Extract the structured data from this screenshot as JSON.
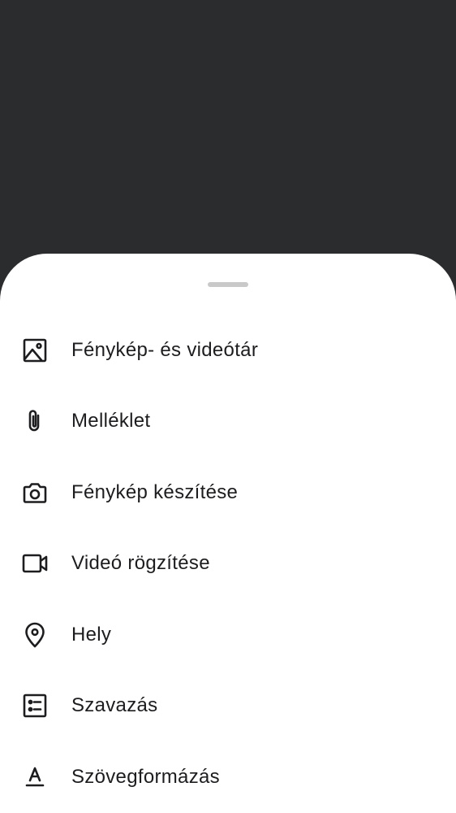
{
  "sheet": {
    "items": [
      {
        "label": "Fénykép- és videótár",
        "icon": "image-icon"
      },
      {
        "label": "Melléklet",
        "icon": "paperclip-icon"
      },
      {
        "label": "Fénykép készítése",
        "icon": "camera-icon"
      },
      {
        "label": "Videó rögzítése",
        "icon": "videocam-icon"
      },
      {
        "label": "Hely",
        "icon": "location-pin-icon"
      },
      {
        "label": "Szavazás",
        "icon": "poll-icon"
      },
      {
        "label": "Szövegformázás",
        "icon": "text-format-icon"
      }
    ]
  },
  "colors": {
    "backdrop": "#2b2c2e",
    "sheet": "#ffffff",
    "text": "#1d1d1f",
    "handle": "#c9c9c9"
  }
}
